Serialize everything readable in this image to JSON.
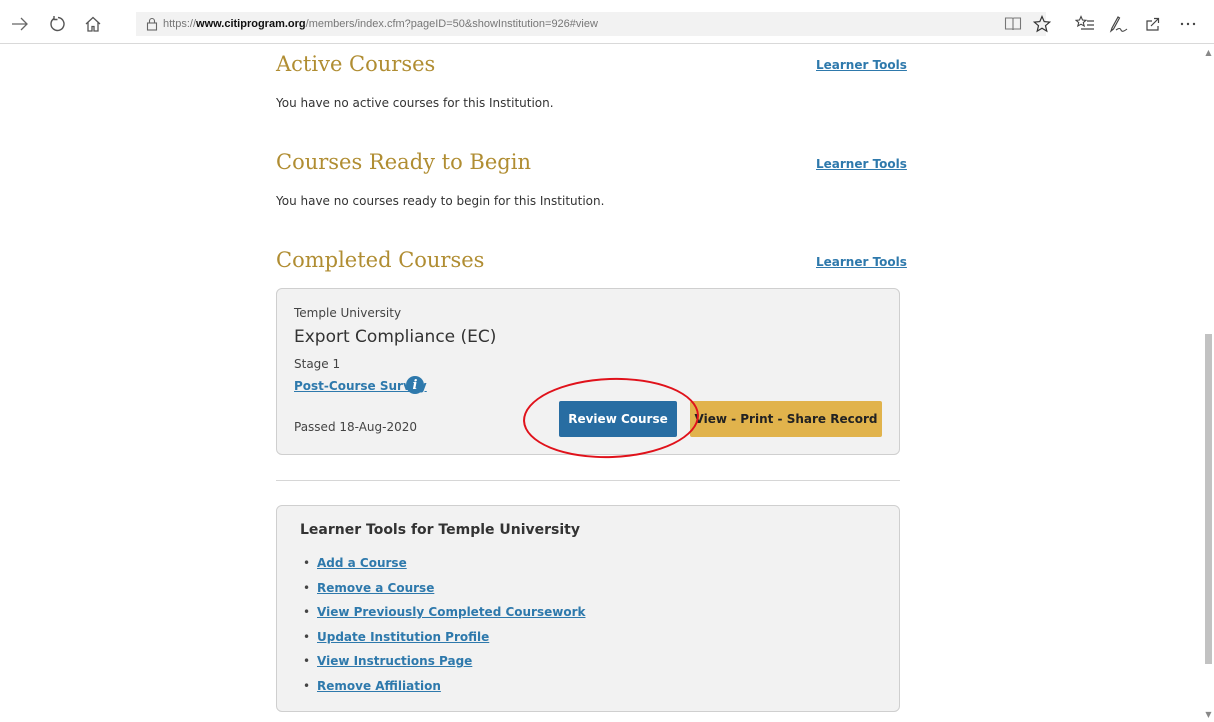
{
  "browser": {
    "url_scheme": "https://",
    "url_host": "www.citiprogram.org",
    "url_path": "/members/index.cfm?pageID=50&showInstitution=926#view",
    "icons": [
      "forward-icon",
      "refresh-icon",
      "home-icon",
      "lock-icon",
      "reading-view-icon",
      "favorite-star-icon",
      "favorites-list-icon",
      "pen-icon",
      "share-icon",
      "more-icon"
    ]
  },
  "sections": {
    "active": {
      "title": "Active Courses",
      "link": "Learner Tools",
      "message": "You have no active courses for this Institution."
    },
    "ready": {
      "title": "Courses Ready to Begin",
      "link": "Learner Tools",
      "message": "You have no courses ready to begin for this Institution."
    },
    "completed": {
      "title": "Completed Courses",
      "link": "Learner Tools"
    }
  },
  "course_card": {
    "institution": "Temple University",
    "course_name": "Export Compliance (EC)",
    "stage": "Stage 1",
    "survey_link": "Post-Course Survey",
    "info_glyph": "i",
    "status": "Passed 18-Aug-2020",
    "review_button": "Review Course",
    "record_button": "View - Print - Share Record"
  },
  "learner_tools": {
    "title": "Learner Tools for Temple University",
    "bullet": "•",
    "items": [
      "Add a Course",
      "Remove a Course",
      "View Previously Completed Coursework",
      "Update Institution Profile",
      "View Instructions Page",
      "Remove Affiliation"
    ]
  },
  "colors": {
    "heading_gold": "#b08d32",
    "link_blue": "#2e79ac",
    "review_button": "#286da2",
    "record_button": "#e1b34c",
    "annotation_red": "#e0121b"
  }
}
